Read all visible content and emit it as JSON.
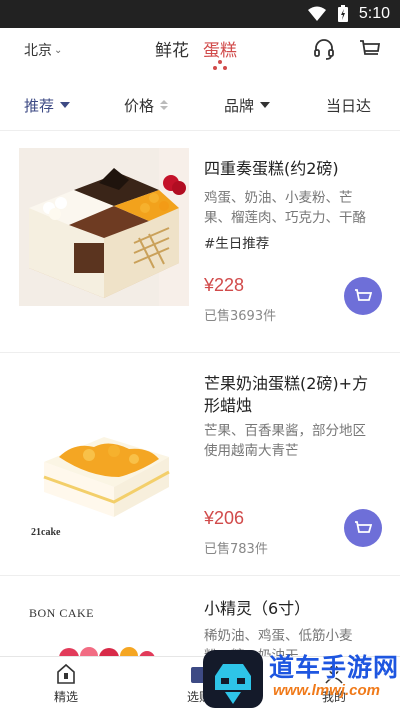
{
  "status_bar": {
    "time": "5:10"
  },
  "header": {
    "city": "北京",
    "tabs": [
      {
        "label": "鲜花"
      },
      {
        "label": "蛋糕"
      }
    ]
  },
  "filters": {
    "recommend": "推荐",
    "price": "价格",
    "brand": "品牌",
    "same_day": "当日达"
  },
  "products": [
    {
      "name": "四重奏蛋糕(约2磅)",
      "desc": "鸡蛋、奶油、小麦粉、芒果、榴莲肉、巧克力、干酪",
      "tag": "#生日推荐",
      "price": "¥228",
      "sold": "已售3693件"
    },
    {
      "name": "芒果奶油蛋糕(2磅)+方形蜡烛",
      "desc": "芒果、百香果酱，部分地区使用越南大青芒",
      "price": "¥206",
      "sold": "已售783件",
      "brand_mark": "21cake"
    },
    {
      "name": "小精灵（6寸）",
      "desc": "稀奶油、鸡蛋、低筋小麦粉、糖、奶油干",
      "brand_mark": "BON CAKE"
    }
  ],
  "bottom_nav": {
    "home": "精选",
    "select": "选购",
    "mine": "我的"
  },
  "watermark": {
    "text": "道车手游网",
    "url": "www.lmwj.com"
  },
  "colors": {
    "accent": "#d14b4b",
    "nav_active": "#3d4a84",
    "cart": "#6e6fd8"
  }
}
